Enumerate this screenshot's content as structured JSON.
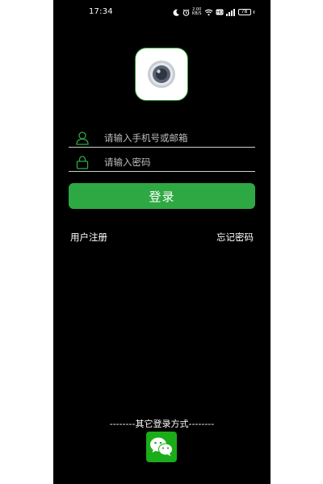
{
  "status_bar": {
    "time": "17:34",
    "network_speed_value": "2.00",
    "network_speed_unit": "KB/S",
    "battery_level": "78",
    "icons": [
      "moon-icon",
      "alarm-icon",
      "wifi-icon",
      "hd-icon",
      "signal-icon",
      "battery-icon"
    ]
  },
  "login": {
    "app_logo_icon": "camera-icon",
    "username_placeholder": "请输入手机号或邮箱",
    "password_placeholder": "请输入密码",
    "login_button_label": "登录",
    "register_link": "用户注册",
    "forgot_password_link": "忘记密码",
    "other_login_label": "--------其它登录方式--------",
    "wechat_icon": "wechat-icon"
  },
  "colors": {
    "background": "#000000",
    "accent_green": "#2ea843",
    "wechat_green": "#1aad19",
    "text": "#ffffff"
  }
}
